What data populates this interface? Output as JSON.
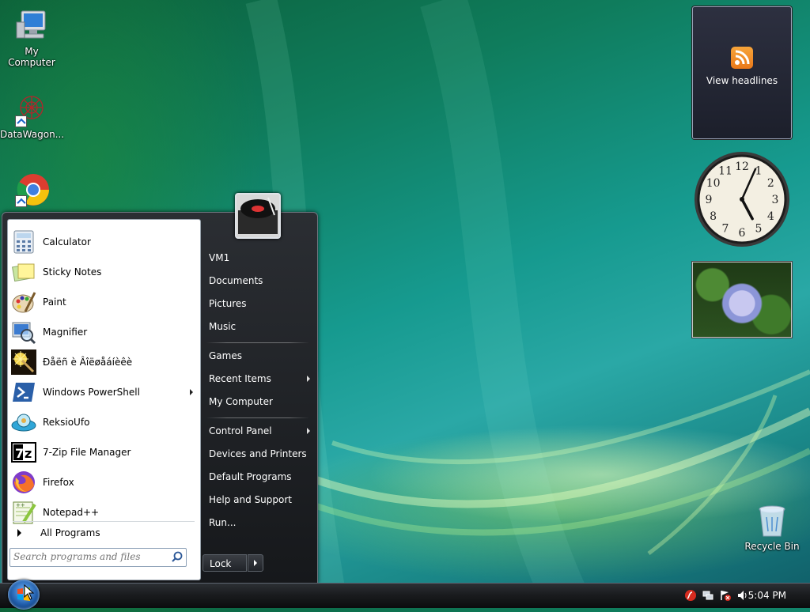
{
  "desktop": {
    "icons": [
      {
        "label": "My Computer",
        "icon": "monitor-icon"
      },
      {
        "label": "DataWagon...",
        "icon": "molecule-icon"
      },
      {
        "label": "Recycle Bin",
        "icon": "recycle-bin-icon"
      }
    ]
  },
  "gadgets": {
    "rss": {
      "label": "View headlines",
      "icon": "rss-icon"
    },
    "clock": {
      "hour": 5,
      "minute": 4,
      "numerals": [
        "12",
        "1",
        "2",
        "3",
        "4",
        "5",
        "6",
        "7",
        "8",
        "9",
        "10",
        "11"
      ]
    }
  },
  "start_menu": {
    "programs": [
      {
        "label": "Calculator",
        "icon": "calculator-icon"
      },
      {
        "label": "Sticky Notes",
        "icon": "sticky-notes-icon"
      },
      {
        "label": "Paint",
        "icon": "paint-palette-icon"
      },
      {
        "label": "Magnifier",
        "icon": "magnifier-icon"
      },
      {
        "label": "Ðåëñ è Âîëøåáíèêè",
        "icon": "wand-icon"
      },
      {
        "label": "Windows PowerShell",
        "icon": "powershell-icon",
        "submenu": true
      },
      {
        "label": "ReksioUfo",
        "icon": "ufo-icon"
      },
      {
        "label": "7-Zip File Manager",
        "icon": "7zip-icon"
      },
      {
        "label": "Firefox",
        "icon": "firefox-icon"
      },
      {
        "label": "Notepad++",
        "icon": "notepadpp-icon"
      }
    ],
    "all_programs": "All Programs",
    "search_placeholder": "Search programs and files",
    "right_items": {
      "vm1": "VM1",
      "documents": "Documents",
      "pictures": "Pictures",
      "music": "Music",
      "games": "Games",
      "recent_items": "Recent Items",
      "my_computer": "My Computer",
      "control_panel": "Control Panel",
      "devices_printers": "Devices and Printers",
      "default_programs": "Default Programs",
      "help_support": "Help and Support",
      "run": "Run..."
    },
    "lock_label": "Lock"
  },
  "taskbar": {
    "time": "5:04 PM",
    "tray_icons": [
      "flash-icon",
      "network-icon",
      "action-center-icon",
      "volume-icon"
    ]
  },
  "colors": {
    "accent_blue": "#1f5ba8",
    "menu_dark": "#1c1e22"
  }
}
